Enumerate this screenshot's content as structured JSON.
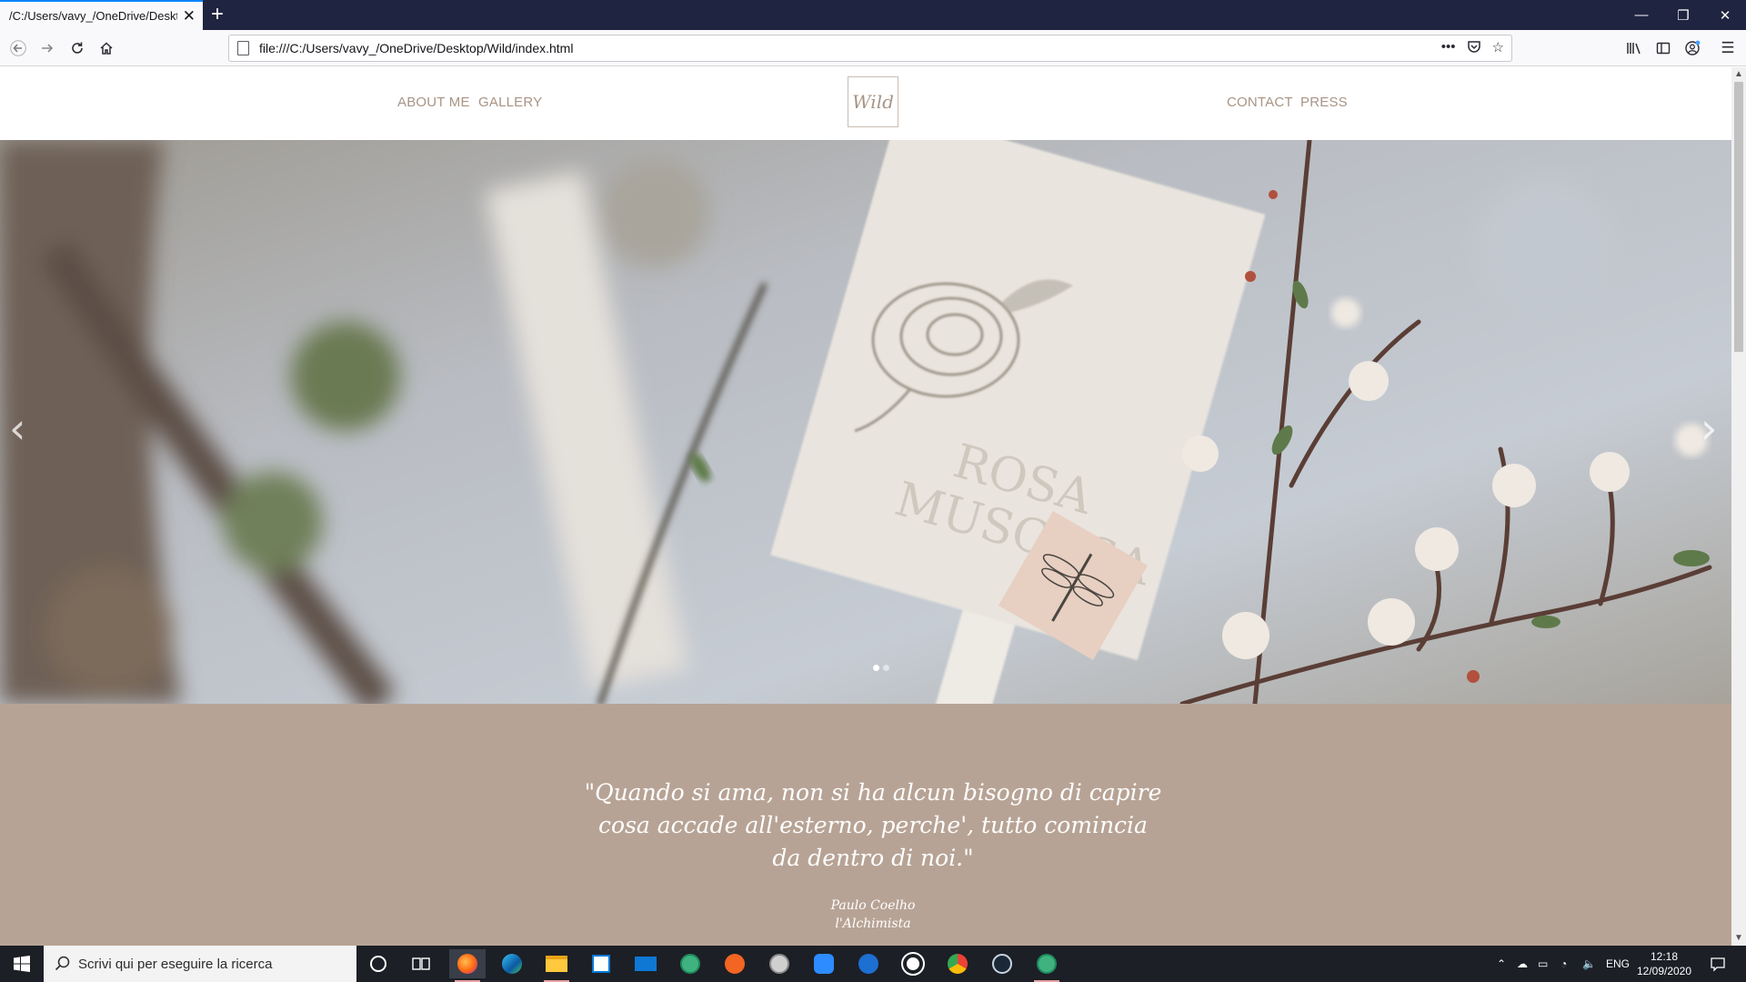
{
  "browser": {
    "tab_title": "/C:/Users/vavy_/OneDrive/Desktop",
    "tab_close": "✕",
    "new_tab": "+",
    "url": "file:///C:/Users/vavy_/OneDrive/Desktop/Wild/index.html"
  },
  "site": {
    "nav_left": [
      "ABOUT ME",
      "GALLERY"
    ],
    "nav_right": [
      "CONTACT",
      "PRESS"
    ],
    "logo_text": "Wild",
    "hero_words": [
      "ROSA",
      "MUSCOSA"
    ],
    "quote": "\"Quando si ama, non si ha alcun bisogno di capire cosa accade all'esterno, perche', tutto comincia da dentro di noi.\"",
    "author": "Paulo Coelho",
    "source": "l'Alchimista",
    "slides": 2,
    "active_slide": 0
  },
  "taskbar": {
    "search_placeholder": "Scrivi qui per eseguire la ricerca",
    "language": "ENG",
    "time": "12:18",
    "date": "12/09/2020"
  },
  "colors": {
    "accent": "#b7a395",
    "nav_text": "#a89484",
    "titlebar": "#1f2440"
  }
}
